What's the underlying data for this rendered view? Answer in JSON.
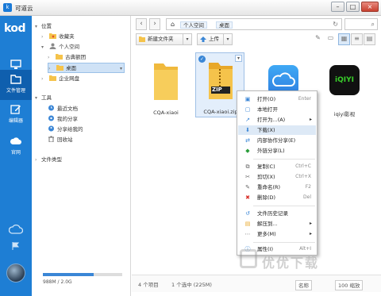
{
  "window": {
    "title": "可道云",
    "minimize": "–",
    "maximize": "□",
    "close": "×"
  },
  "sidebar": {
    "logo": "kod",
    "items": [
      {
        "label": "桌面"
      },
      {
        "label": "文件管理"
      },
      {
        "label": "编辑器"
      },
      {
        "label": "官网"
      }
    ]
  },
  "tree": {
    "location_header": "位置",
    "favorites": "收藏夹",
    "personal_space": "个人空间",
    "classic_circle": "古典额团",
    "desktop": "桌面",
    "enterprise_disk": "企业网盘",
    "tools_header": "工具",
    "recent_docs": "最近文档",
    "my_shares": "我的分享",
    "share_to_me": "分享给我的",
    "recycle": "回收站",
    "file_types": "文件类型",
    "usage_text": "988M / 2.0G",
    "usage_fraction": 0.64
  },
  "pathbar": {
    "back": "‹",
    "forward": "›",
    "crumbs": [
      "个人空间",
      "桌面"
    ],
    "refresh": "↻"
  },
  "toolbar": {
    "new_folder": "新建文件夹",
    "upload": "上传"
  },
  "files": [
    {
      "name": "CQA-xiaoi",
      "type": "folder"
    },
    {
      "name": "CQA-xiaoi.zip",
      "type": "zip",
      "badge": "ZIP"
    },
    {
      "name": "",
      "type": "cloud"
    },
    {
      "name": "iqiyi影视",
      "type": "iqiyi",
      "logo_text": "iQIYI"
    }
  ],
  "status": {
    "item_count": "4 个项目",
    "selected": "1 个选中 (225M)",
    "sort_label": "名称",
    "zoom": "100 缩放"
  },
  "context_menu": {
    "items": [
      {
        "label": "打开(O)",
        "shortcut": "Enter"
      },
      {
        "label": "本地打开",
        "shortcut": ""
      },
      {
        "label": "打开为...(A)",
        "shortcut": "",
        "submenu": "▸"
      },
      {
        "label": "下载(X)",
        "shortcut": ""
      },
      {
        "label": "内部协作分享(E)",
        "shortcut": ""
      },
      {
        "label": "外链分享(L)",
        "shortcut": ""
      },
      {
        "label": "复制(C)",
        "shortcut": "Ctrl+C"
      },
      {
        "label": "剪切(X)",
        "shortcut": "Ctrl+X"
      },
      {
        "label": "重命名(R)",
        "shortcut": "F2"
      },
      {
        "label": "删除(D)",
        "shortcut": "Del"
      },
      {
        "label": "文件历史记录",
        "shortcut": ""
      },
      {
        "label": "解压到...",
        "shortcut": "",
        "submenu": "▸"
      },
      {
        "label": "更多(M)",
        "shortcut": "",
        "submenu": "▸"
      },
      {
        "label": "属性(I)",
        "shortcut": "Alt+I"
      }
    ]
  },
  "watermark": "优优下载",
  "colors": {
    "sidebar": "#1e7ed4",
    "sidebar_active": "#0f5fae",
    "selection": "#cfe2f6",
    "folder": "#f5c34b"
  }
}
